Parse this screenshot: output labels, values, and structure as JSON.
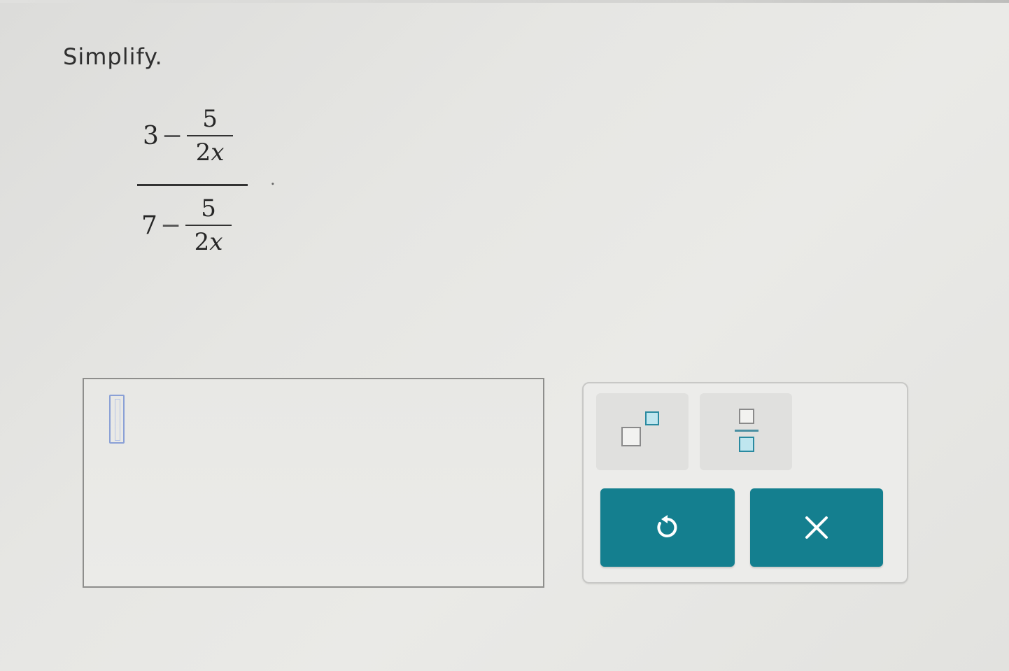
{
  "question": {
    "prompt": "Simplify."
  },
  "expression": {
    "numerator": {
      "whole": "3",
      "operator": "−",
      "fraction_numerator": "5",
      "fraction_denominator_coeff": "2",
      "fraction_denominator_var": "x"
    },
    "denominator": {
      "whole": "7",
      "operator": "−",
      "fraction_numerator": "5",
      "fraction_denominator_coeff": "2",
      "fraction_denominator_var": "x"
    },
    "trailing_punctuation": "."
  },
  "answer": {
    "value": ""
  },
  "keypad": {
    "tools": [
      {
        "name": "exponent",
        "icon": "exponent-template-icon"
      },
      {
        "name": "fraction",
        "icon": "fraction-template-icon"
      }
    ],
    "actions": [
      {
        "name": "undo",
        "icon": "undo-icon"
      },
      {
        "name": "clear",
        "icon": "close-icon"
      }
    ],
    "colors": {
      "action_button": "#147f8f",
      "template_accent": "#2a8aa0"
    }
  }
}
